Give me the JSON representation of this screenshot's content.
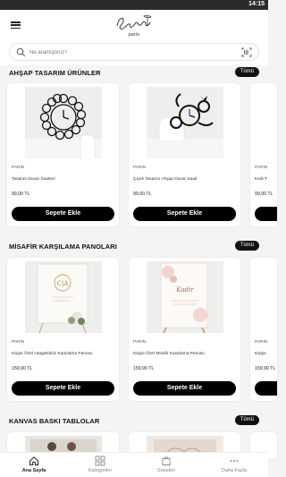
{
  "statusbar": {
    "time": "14:15"
  },
  "header": {
    "logo_sub": "parin",
    "menu_icon": "hamburger-icon"
  },
  "search": {
    "placeholder": "Ne aramıştınız?",
    "icon": "search-icon",
    "scan_icon": "barcode-icon"
  },
  "sections": [
    {
      "title": "AHŞAP TASARIM ÜRÜNLER",
      "all_label": "Tümü",
      "products": [
        {
          "brand": "PARIN",
          "name": "Tasarım Duvar Saatleri",
          "price": "99,00 TL",
          "button": "Sepete Ekle"
        },
        {
          "brand": "PARIN",
          "name": "Çiçek Tasarım Ahşap Duvar Saati",
          "price": "99,00 TL",
          "button": "Sepete Ekle"
        },
        {
          "brand": "PARIN",
          "name": "Kedi T",
          "price": "99,00 TL",
          "button": ""
        }
      ]
    },
    {
      "title": "MİSAFİR KARŞILAMA PANOLARI",
      "all_label": "Tümü",
      "products": [
        {
          "brand": "PARIN",
          "name": "Kişiye Özel Hoşgeldiniz Karşılama Panosu",
          "price": "159,90 TL",
          "button": "Sepete Ekle",
          "image_text": "C|A"
        },
        {
          "brand": "PARIN",
          "name": "Kişiye Özel Misafir Karşılama Panosu",
          "price": "159,90 TL",
          "button": "Sepete Ekle",
          "image_text": "Kadir"
        },
        {
          "brand": "PARIN",
          "name": "Kişiye",
          "price": "159,90 TL",
          "button": ""
        }
      ]
    },
    {
      "title": "KANVAS BASKI TABLOLAR",
      "all_label": "Tümü",
      "products": []
    }
  ],
  "bottom_nav": [
    {
      "label": "Ana Sayfa",
      "icon": "home-icon",
      "active": true
    },
    {
      "label": "Kategoriler",
      "icon": "grid-icon",
      "active": false
    },
    {
      "label": "Sepetim",
      "icon": "cart-icon",
      "active": false
    },
    {
      "label": "Daha Fazla",
      "icon": "more-icon",
      "active": false
    }
  ]
}
